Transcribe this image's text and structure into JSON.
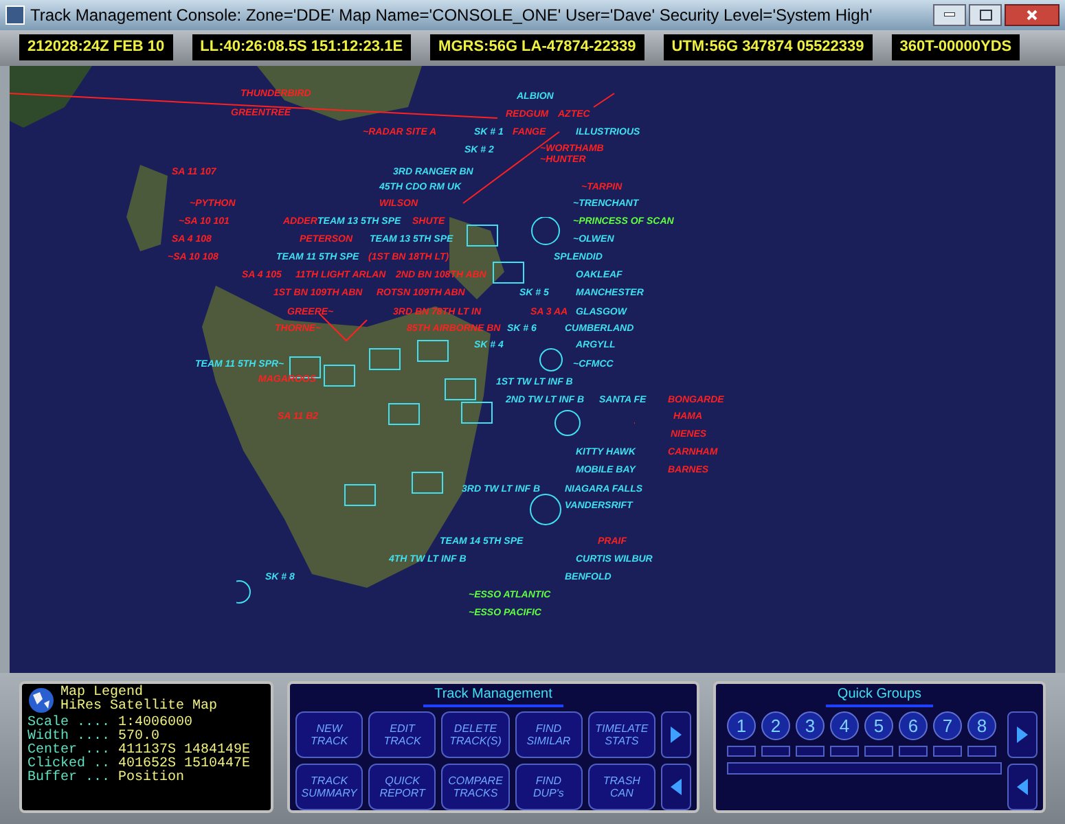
{
  "window": {
    "title": "Track Management Console: Zone='DDE' Map Name='CONSOLE_ONE' User='Dave' Security Level='System High'"
  },
  "readouts": [
    "212028:24Z FEB 10",
    "LL:40:26:08.5S 151:12:23.1E",
    "MGRS:56G LA-47874-22339",
    "UTM:56G 347874 05522339",
    "360T-00000YDS"
  ],
  "map": {
    "tracks": [
      {
        "label": "THUNDERBIRD",
        "color": "#ff2020"
      },
      {
        "label": "ALBION",
        "color": "#40e0f0"
      },
      {
        "label": "GREENTREE",
        "color": "#ff2020"
      },
      {
        "label": "REDGUM",
        "color": "#ff2020"
      },
      {
        "label": "AZTEC",
        "color": "#ff2020"
      },
      {
        "label": "~RADAR SITE A",
        "color": "#ff2020"
      },
      {
        "label": "SK # 1",
        "color": "#40e0f0"
      },
      {
        "label": "FANGE",
        "color": "#ff2020"
      },
      {
        "label": "ILLUSTRIOUS",
        "color": "#40e0f0"
      },
      {
        "label": "SK # 2",
        "color": "#40e0f0"
      },
      {
        "label": "~WORTHAMB",
        "color": "#ff2020"
      },
      {
        "label": "~HUNTER",
        "color": "#ff2020"
      },
      {
        "label": "SA 11 107",
        "color": "#ff2020"
      },
      {
        "label": "3RD RANGER BN",
        "color": "#40e0f0"
      },
      {
        "label": "45TH CDO RM UK",
        "color": "#40e0f0"
      },
      {
        "label": "~TARPIN",
        "color": "#ff2020"
      },
      {
        "label": "~PYTHON",
        "color": "#ff2020"
      },
      {
        "label": "WILSON",
        "color": "#ff2020"
      },
      {
        "label": "~TRENCHANT",
        "color": "#40e0f0"
      },
      {
        "label": "~SA 10 101",
        "color": "#ff2020"
      },
      {
        "label": "ADDER",
        "color": "#ff2020"
      },
      {
        "label": "TEAM 13 5TH SPE",
        "color": "#40e0f0"
      },
      {
        "label": "SHUTE",
        "color": "#ff2020"
      },
      {
        "label": "~PRINCESS OF SCAN",
        "color": "#60ff40"
      },
      {
        "label": "SA 4 108",
        "color": "#ff2020"
      },
      {
        "label": "PETERSON",
        "color": "#ff2020"
      },
      {
        "label": "TEAM 13 5TH SPE",
        "color": "#40e0f0"
      },
      {
        "label": "~OLWEN",
        "color": "#40e0f0"
      },
      {
        "label": "~SA 10 108",
        "color": "#ff2020"
      },
      {
        "label": "TEAM 11 5TH SPE",
        "color": "#40e0f0"
      },
      {
        "label": "(1ST BN 18TH LT)",
        "color": "#ff2020"
      },
      {
        "label": "SPLENDID",
        "color": "#40e0f0"
      },
      {
        "label": "SA 4 105",
        "color": "#ff2020"
      },
      {
        "label": "11TH LIGHT ARLAN",
        "color": "#ff2020"
      },
      {
        "label": "2ND BN 108TH ABN",
        "color": "#ff2020"
      },
      {
        "label": "OAKLEAF",
        "color": "#40e0f0"
      },
      {
        "label": "1ST BN 109TH ABN",
        "color": "#ff2020"
      },
      {
        "label": "ROTSN 109TH ABN",
        "color": "#ff2020"
      },
      {
        "label": "SK # 5",
        "color": "#40e0f0"
      },
      {
        "label": "MANCHESTER",
        "color": "#40e0f0"
      },
      {
        "label": "GREERE~",
        "color": "#ff2020"
      },
      {
        "label": "3RD BN 78TH LT IN",
        "color": "#ff2020"
      },
      {
        "label": "SA 3 AA",
        "color": "#ff2020"
      },
      {
        "label": "GLASGOW",
        "color": "#40e0f0"
      },
      {
        "label": "THORNE~",
        "color": "#ff2020"
      },
      {
        "label": "85TH AIRBORNE BN",
        "color": "#ff2020"
      },
      {
        "label": "SK # 6",
        "color": "#40e0f0"
      },
      {
        "label": "CUMBERLAND",
        "color": "#40e0f0"
      },
      {
        "label": "SK # 4",
        "color": "#40e0f0"
      },
      {
        "label": "ARGYLL",
        "color": "#40e0f0"
      },
      {
        "label": "TEAM 11 5TH SPR~",
        "color": "#40e0f0"
      },
      {
        "label": "~CFMCC",
        "color": "#40e0f0"
      },
      {
        "label": "MAGAROOS",
        "color": "#ff2020"
      },
      {
        "label": "1ST TW LT INF B",
        "color": "#40e0f0"
      },
      {
        "label": "2ND TW LT INF B",
        "color": "#40e0f0"
      },
      {
        "label": "SANTA FE",
        "color": "#40e0f0"
      },
      {
        "label": "BONGARDE",
        "color": "#ff2020"
      },
      {
        "label": "SA 11 B2",
        "color": "#ff2020"
      },
      {
        "label": "HAMA",
        "color": "#ff2020"
      },
      {
        "label": "NIENES",
        "color": "#ff2020"
      },
      {
        "label": "KITTY HAWK",
        "color": "#40e0f0"
      },
      {
        "label": "CARNHAM",
        "color": "#ff2020"
      },
      {
        "label": "MOBILE BAY",
        "color": "#40e0f0"
      },
      {
        "label": "BARNES",
        "color": "#ff2020"
      },
      {
        "label": "3RD TW LT INF B",
        "color": "#40e0f0"
      },
      {
        "label": "NIAGARA FALLS",
        "color": "#40e0f0"
      },
      {
        "label": "VANDERSRIFT",
        "color": "#40e0f0"
      },
      {
        "label": "TEAM 14 5TH SPE",
        "color": "#40e0f0"
      },
      {
        "label": "PRAIF",
        "color": "#ff2020"
      },
      {
        "label": "4TH TW LT INF B",
        "color": "#40e0f0"
      },
      {
        "label": "CURTIS WILBUR",
        "color": "#40e0f0"
      },
      {
        "label": "SK # 8",
        "color": "#40e0f0"
      },
      {
        "label": "BENFOLD",
        "color": "#40e0f0"
      },
      {
        "label": "~ESSO ATLANTIC",
        "color": "#60ff40"
      },
      {
        "label": "~ESSO PACIFIC",
        "color": "#60ff40"
      }
    ]
  },
  "legend": {
    "title": "Map Legend",
    "subtitle": "HiRes Satellite Map",
    "rows": [
      {
        "key": "Scale ....",
        "value": "1:4006000"
      },
      {
        "key": "Width ....",
        "value": "570.0"
      },
      {
        "key": "Center ...",
        "value": "411137S 1484149E"
      },
      {
        "key": "Clicked ..",
        "value": "401652S 1510447E"
      },
      {
        "key": "Buffer ...",
        "value": "Position"
      }
    ]
  },
  "track_management": {
    "title": "Track Management",
    "buttons": [
      "NEW TRACK",
      "EDIT TRACK",
      "DELETE TRACK(S)",
      "FIND SIMILAR",
      "TIMELATE STATS",
      "TRACK SUMMARY",
      "QUICK REPORT",
      "COMPARE TRACKS",
      "FIND DUP's",
      "TRASH CAN"
    ]
  },
  "quick_groups": {
    "title": "Quick Groups",
    "groups": [
      "1",
      "2",
      "3",
      "4",
      "5",
      "6",
      "7",
      "8"
    ]
  }
}
